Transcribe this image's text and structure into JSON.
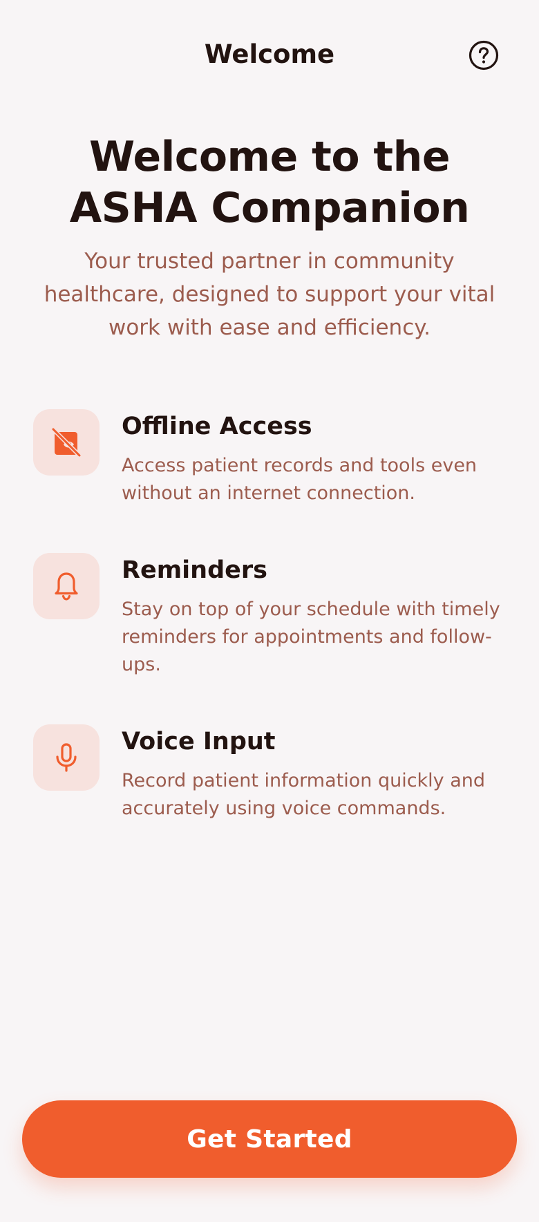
{
  "header": {
    "title": "Welcome",
    "help_icon": "help-circle-icon"
  },
  "hero": {
    "title": "Welcome to the ASHA Companion",
    "subtitle": "Your trusted partner in community healthcare, designed to support your vital work with ease and efficiency."
  },
  "features": [
    {
      "icon": "offline-icon",
      "title": "Offline Access",
      "description": "Access patient records and tools even without an internet connection."
    },
    {
      "icon": "bell-icon",
      "title": "Reminders",
      "description": "Stay on top of your schedule with timely reminders for appointments and follow-ups."
    },
    {
      "icon": "microphone-icon",
      "title": "Voice Input",
      "description": "Record patient information quickly and accurately using voice commands."
    }
  ],
  "cta": {
    "label": "Get Started"
  },
  "colors": {
    "background": "#f8f5f6",
    "accent": "#f05d2d",
    "icon_tile": "#f7e2de",
    "muted_text": "#9c5c4e",
    "primary_text": "#221310"
  }
}
